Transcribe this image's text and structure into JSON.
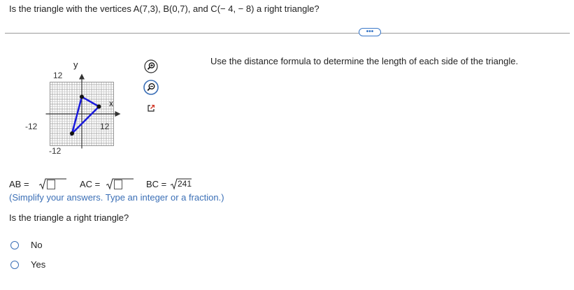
{
  "question": {
    "text": "Is the triangle with the vertices A(7,3), B(0,7), and C(− 4, − 8) a right triangle?"
  },
  "more_button": {
    "label": "•••"
  },
  "instruction": "Use the distance formula to determine the length of each side of the triangle.",
  "graph": {
    "y_axis_label": "y",
    "x_axis_label": "x",
    "tick_labels": {
      "y_top": "12",
      "y_bottom": "-12",
      "x_left": "-12",
      "x_right": "12"
    },
    "x_range": [
      -13,
      13
    ],
    "y_range": [
      -13,
      13
    ],
    "vertices": [
      {
        "name": "A",
        "x": 7,
        "y": 3
      },
      {
        "name": "B",
        "x": 0,
        "y": 7
      },
      {
        "name": "C",
        "x": -4,
        "y": -8
      }
    ],
    "triangle_color": "#1a1adb",
    "vertex_color": "#111111"
  },
  "tools": {
    "zoom_in": "zoom-in-icon",
    "zoom_out": "zoom-out-icon",
    "expand": "expand-icon"
  },
  "answers": {
    "ab_label": "AB =",
    "ac_label": "AC =",
    "bc_label": "BC =",
    "bc_value": "241"
  },
  "hint": "(Simplify your answers. Type an integer or a fraction.)",
  "question2": "Is the triangle a right triangle?",
  "options": [
    {
      "label": "No"
    },
    {
      "label": "Yes"
    }
  ],
  "colors": {
    "accent": "#3b6fb6",
    "text": "#222222"
  }
}
